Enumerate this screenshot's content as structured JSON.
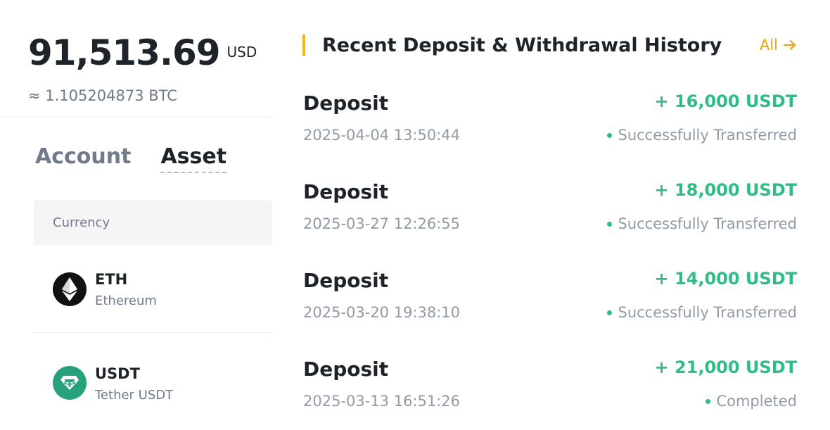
{
  "balance": {
    "amount": "91,513.69",
    "currency": "USD",
    "btc_equivalent": "≈ 1.105204873 BTC"
  },
  "tabs": [
    {
      "label": "Account",
      "active": false
    },
    {
      "label": "Asset",
      "active": true
    }
  ],
  "asset_table": {
    "header": "Currency",
    "rows": [
      {
        "symbol": "ETH",
        "name": "Ethereum",
        "icon": "ethereum-icon",
        "icon_bg": "#111111"
      },
      {
        "symbol": "USDT",
        "name": "Tether USDT",
        "icon": "tether-icon",
        "icon_bg": "#26a17b"
      }
    ]
  },
  "history": {
    "title": "Recent Deposit & Withdrawal History",
    "all_label": "All",
    "accent_color": "#f0b90b",
    "items": [
      {
        "type": "Deposit",
        "amount": "+ 16,000 USDT",
        "time": "2025-04-04 13:50:44",
        "status": "Successfully Transferred"
      },
      {
        "type": "Deposit",
        "amount": "+ 18,000 USDT",
        "time": "2025-03-27 12:26:55",
        "status": "Successfully Transferred"
      },
      {
        "type": "Deposit",
        "amount": "+ 14,000 USDT",
        "time": "2025-03-20 19:38:10",
        "status": "Successfully Transferred"
      },
      {
        "type": "Deposit",
        "amount": "+ 21,000 USDT",
        "time": "2025-03-13 16:51:26",
        "status": "Completed"
      }
    ]
  },
  "colors": {
    "positive": "#2ebd85",
    "link": "#e8a317",
    "muted": "#707a8a"
  }
}
